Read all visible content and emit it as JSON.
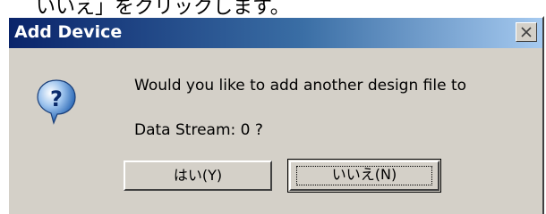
{
  "page": {
    "top_text": "いいえ」をクリックします。"
  },
  "dialog": {
    "title": "Add Device",
    "close_icon": "close-icon",
    "question_icon": "question-icon",
    "message_line1": "Would you like to add another design file to",
    "message_line2": "Data Stream: 0 ?",
    "yes_label": "はい(Y)",
    "no_label": "いいえ(N)"
  },
  "colors": {
    "dialog_bg": "#d4d0c8",
    "titlebar_start": "#0a246a",
    "titlebar_end": "#a6caf0"
  }
}
